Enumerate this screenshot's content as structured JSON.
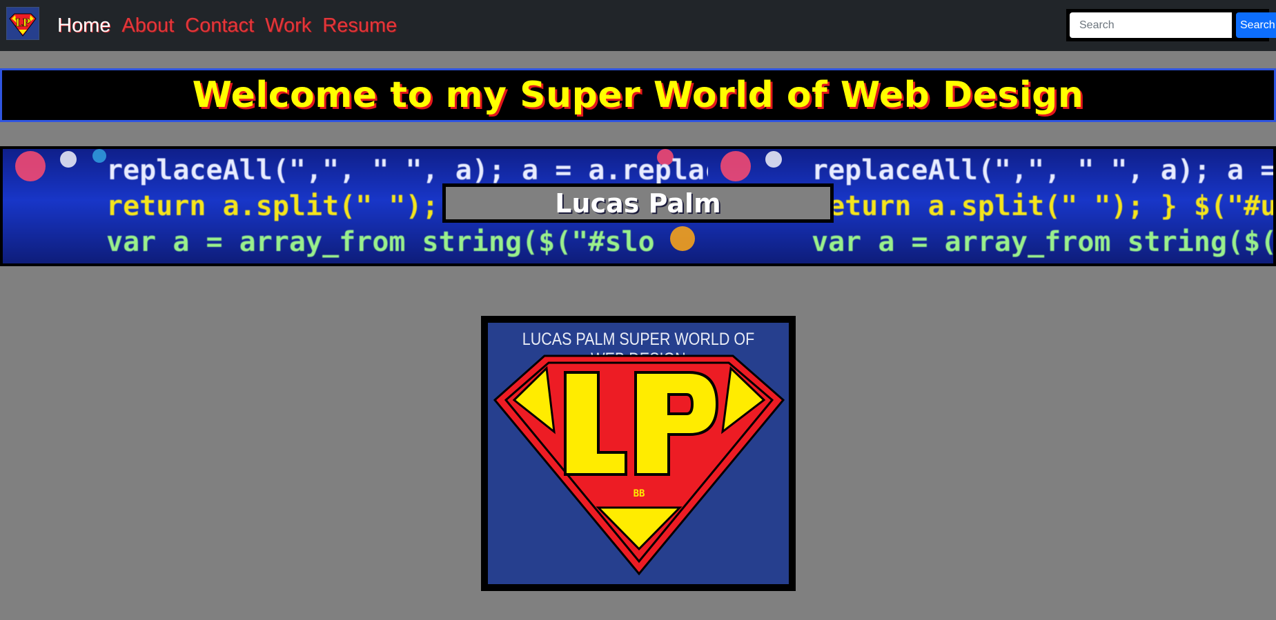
{
  "nav": {
    "links": [
      {
        "label": "Home",
        "active": true
      },
      {
        "label": "About",
        "active": false
      },
      {
        "label": "Contact",
        "active": false
      },
      {
        "label": "Work",
        "active": false
      },
      {
        "label": "Resume",
        "active": false
      }
    ],
    "search": {
      "placeholder": "Search",
      "button_label": "Search"
    }
  },
  "welcome": {
    "title": "Welcome to my Super World of Web Design"
  },
  "banner": {
    "name": "Lucas Palm",
    "code_lines": [
      "replaceAll(\",\", \" \", a); a = a.replace",
      "return a.split(\" \"); } $(\"#unique",
      "var a = array_from string($(\"#slo"
    ]
  },
  "logo": {
    "caption": "LUCAS PALM SUPER WORLD OF WEB DESIGN",
    "monogram": "LP",
    "small_text": "BB"
  },
  "colors": {
    "nav_bg": "#212529",
    "page_bg": "#808080",
    "link": "#e3373b",
    "title_yellow": "#ffff00",
    "accent_blue": "#0d6efd",
    "logo_blue": "#263f8e",
    "logo_red": "#ed1c24"
  }
}
